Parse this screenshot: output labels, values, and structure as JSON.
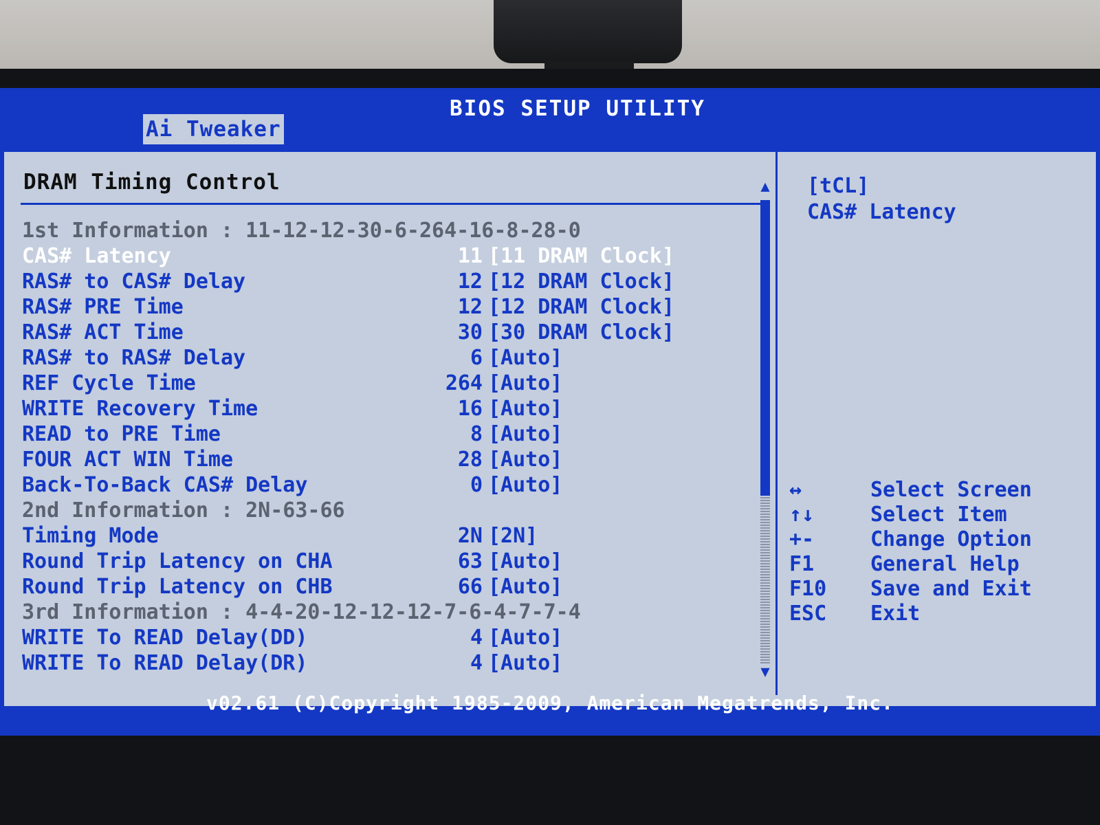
{
  "bios": {
    "title": "BIOS SETUP UTILITY",
    "active_tab": "Ai Tweaker",
    "footer": "v02.61 (C)Copyright 1985-2009, American Megatrends, Inc."
  },
  "left_pane": {
    "section_title": "DRAM Timing Control",
    "rows": [
      {
        "label": "1st Information : 11-12-12-30-6-264-16-8-28-0",
        "current": "",
        "setting": "",
        "kind": "info"
      },
      {
        "label": "CAS# Latency",
        "current": "11",
        "setting": "[11 DRAM Clock]",
        "kind": "selected"
      },
      {
        "label": "RAS# to CAS# Delay",
        "current": "12",
        "setting": "[12 DRAM Clock]",
        "kind": "option"
      },
      {
        "label": "RAS# PRE Time",
        "current": "12",
        "setting": "[12 DRAM Clock]",
        "kind": "option"
      },
      {
        "label": "RAS# ACT Time",
        "current": "30",
        "setting": "[30 DRAM Clock]",
        "kind": "option"
      },
      {
        "label": "RAS# to RAS# Delay",
        "current": "6",
        "setting": "[Auto]",
        "kind": "option"
      },
      {
        "label": "REF Cycle Time",
        "current": "264",
        "setting": "[Auto]",
        "kind": "option"
      },
      {
        "label": "WRITE Recovery Time",
        "current": "16",
        "setting": "[Auto]",
        "kind": "option"
      },
      {
        "label": "READ to PRE Time",
        "current": "8",
        "setting": "[Auto]",
        "kind": "option"
      },
      {
        "label": "FOUR ACT WIN Time",
        "current": "28",
        "setting": "[Auto]",
        "kind": "option"
      },
      {
        "label": "Back-To-Back CAS# Delay",
        "current": "0",
        "setting": "[Auto]",
        "kind": "option"
      },
      {
        "label": "2nd Information : 2N-63-66",
        "current": "",
        "setting": "",
        "kind": "info"
      },
      {
        "label": "Timing Mode",
        "current": "2N",
        "setting": "[2N]",
        "kind": "option"
      },
      {
        "label": "Round Trip Latency on CHA",
        "current": "63",
        "setting": "[Auto]",
        "kind": "option"
      },
      {
        "label": "Round Trip Latency on CHB",
        "current": "66",
        "setting": "[Auto]",
        "kind": "option"
      },
      {
        "label": "3rd Information : 4-4-20-12-12-12-7-6-4-7-7-4",
        "current": "",
        "setting": "",
        "kind": "info"
      },
      {
        "label": "WRITE To READ Delay(DD)",
        "current": "4",
        "setting": "[Auto]",
        "kind": "option"
      },
      {
        "label": "WRITE To READ Delay(DR)",
        "current": "4",
        "setting": "[Auto]",
        "kind": "option"
      }
    ],
    "scroll": {
      "up_arrow": "▲",
      "down_arrow": "▼"
    }
  },
  "help_pane": {
    "tag": "[tCL]",
    "description": "CAS# Latency",
    "keys": [
      {
        "key": "↔",
        "action": "Select Screen"
      },
      {
        "key": "↑↓",
        "action": "Select Item"
      },
      {
        "key": "+-",
        "action": "Change Option"
      },
      {
        "key": "F1",
        "action": "General Help"
      },
      {
        "key": "F10",
        "action": "Save and Exit"
      },
      {
        "key": "ESC",
        "action": "Exit"
      }
    ]
  },
  "colors": {
    "bios_blue": "#1438c4",
    "panel_gray": "#c4cede",
    "info_gray": "#5b6270",
    "selected_white": "#ffffff"
  }
}
